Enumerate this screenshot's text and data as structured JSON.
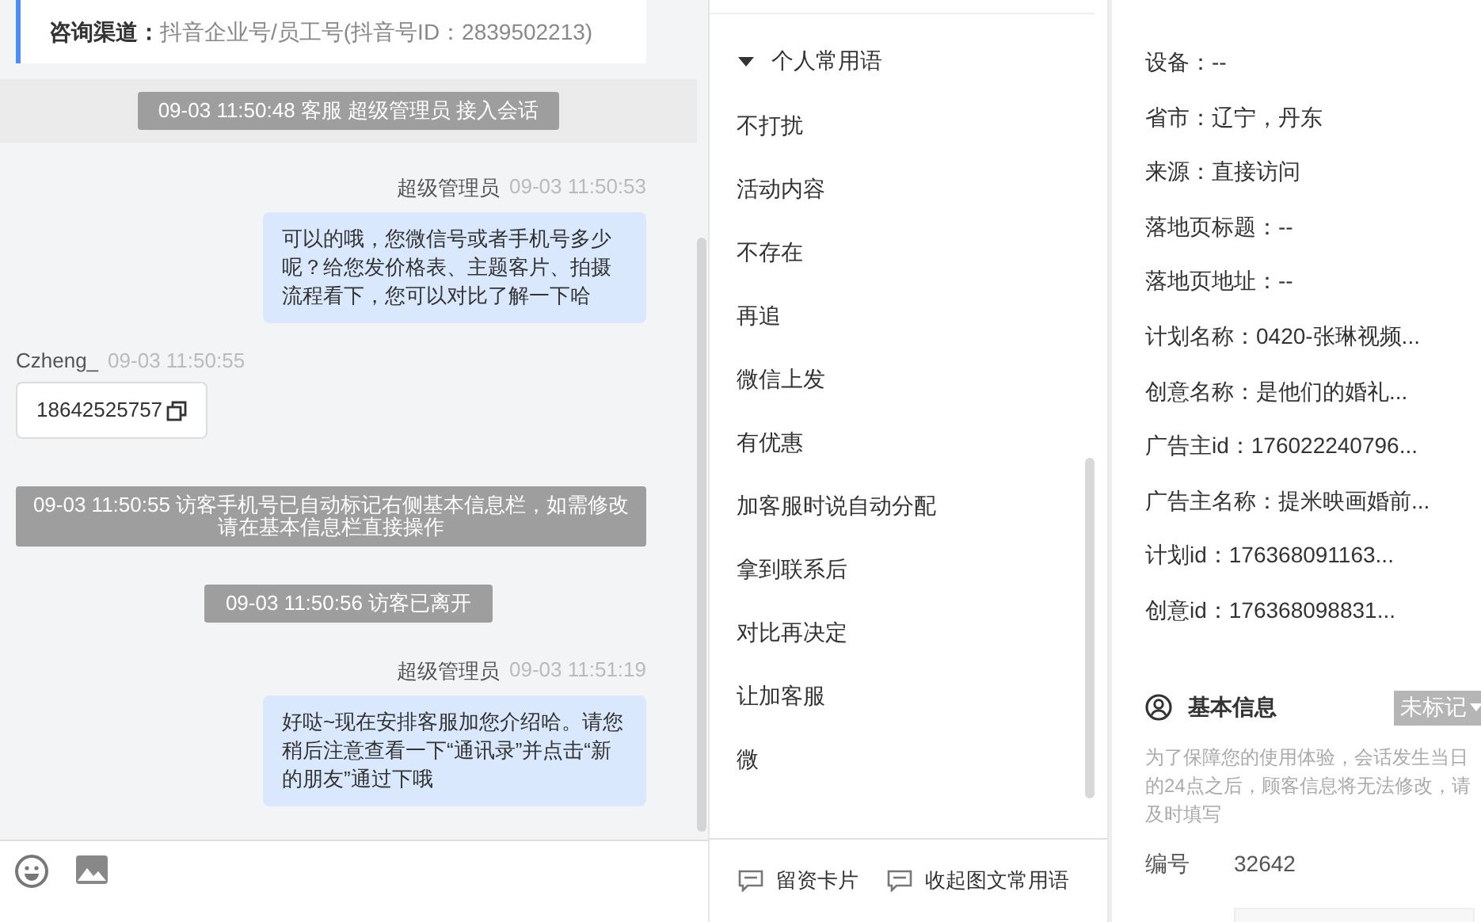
{
  "chat": {
    "channel": {
      "label": "咨询渠道：",
      "value": "抖音企业号/员工号(抖音号ID：2839502213)"
    },
    "messages": [
      {
        "kind": "banner",
        "text": "09-03 11:50:48 客服 超级管理员 接入会话"
      },
      {
        "kind": "agent",
        "sender": "超级管理员",
        "time": "09-03 11:50:53",
        "text": "可以的哦，您微信号或者手机号多少呢？给您发价格表、主题客片、拍摄流程看下，您可以对比了解一下哈"
      },
      {
        "kind": "visitor",
        "sender": "Czheng_",
        "time": "09-03 11:50:55",
        "text": "18642525757"
      },
      {
        "kind": "system",
        "text": "09-03 11:50:55 访客手机号已自动标记右侧基本信息栏，如需修改请在基本信息栏直接操作"
      },
      {
        "kind": "system",
        "text": "09-03 11:50:56 访客已离开"
      },
      {
        "kind": "agent",
        "sender": "超级管理员",
        "time": "09-03 11:51:19",
        "text": "好哒~现在安排客服加您介绍哈。请您稍后注意查看一下“通讯录”并点击“新的朋友”通过下哦"
      }
    ]
  },
  "phrases": {
    "group": {
      "title": "个人常用语",
      "expanded": true
    },
    "items": [
      "不打扰",
      "活动内容",
      "不存在",
      "再追",
      "微信上发",
      "有优惠",
      "加客服时说自动分配",
      "拿到联系后",
      "对比再决定",
      "让加客服",
      "微"
    ],
    "buttons": [
      "留资卡片",
      "收起图文常用语"
    ]
  },
  "source_info": {
    "fields": [
      "设备：--",
      "省市：辽宁，丹东",
      "来源：直接访问",
      "落地页标题：--",
      "落地页地址：--",
      "计划名称：0420-张琳视频...",
      "创意名称：是他们的婚礼...",
      "广告主id：176022240796...",
      "广告主名称：提米映画婚前...",
      "计划id：176368091163...",
      "创意id：176368098831..."
    ]
  },
  "basic_info": {
    "title": "基本信息",
    "tag": "未标记",
    "note_lines": [
      "为了保障您的使用体验，会话发生当日",
      "的24点之后，顾客信息将无法修改，请",
      "及时填写"
    ],
    "fields": [
      {
        "label": "编号",
        "value": "32642"
      }
    ]
  }
}
